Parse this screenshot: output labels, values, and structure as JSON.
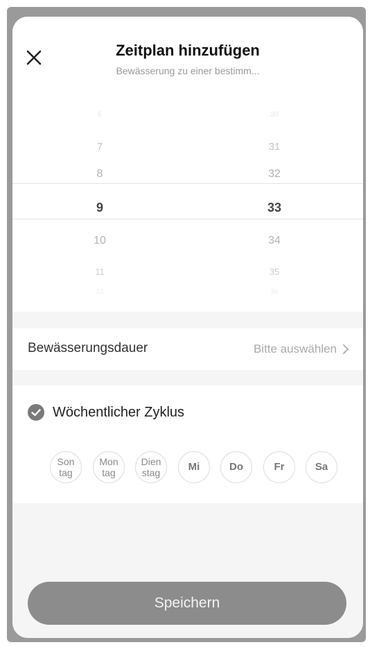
{
  "header": {
    "title": "Zeitplan hinzufügen",
    "subtitle": "Bewässerung zu einer bestimm..."
  },
  "picker": {
    "hours": [
      "6",
      "7",
      "8",
      "9",
      "10",
      "11",
      "12"
    ],
    "minutes": [
      "30",
      "31",
      "32",
      "33",
      "34",
      "35",
      "36"
    ],
    "selected_hour": "9",
    "selected_minute": "33"
  },
  "duration": {
    "label": "Bewässerungsdauer",
    "value": "Bitte auswählen"
  },
  "weekly": {
    "label": "Wöchentlicher Zyklus",
    "checked": true,
    "days": [
      "Son\ntag",
      "Mon\ntag",
      "Dien\nstag",
      "Mi",
      "Do",
      "Fr",
      "Sa"
    ]
  },
  "save": {
    "label": "Speichern"
  },
  "colors": {
    "button": "#8c8c8c",
    "check": "#7a7a7a"
  }
}
